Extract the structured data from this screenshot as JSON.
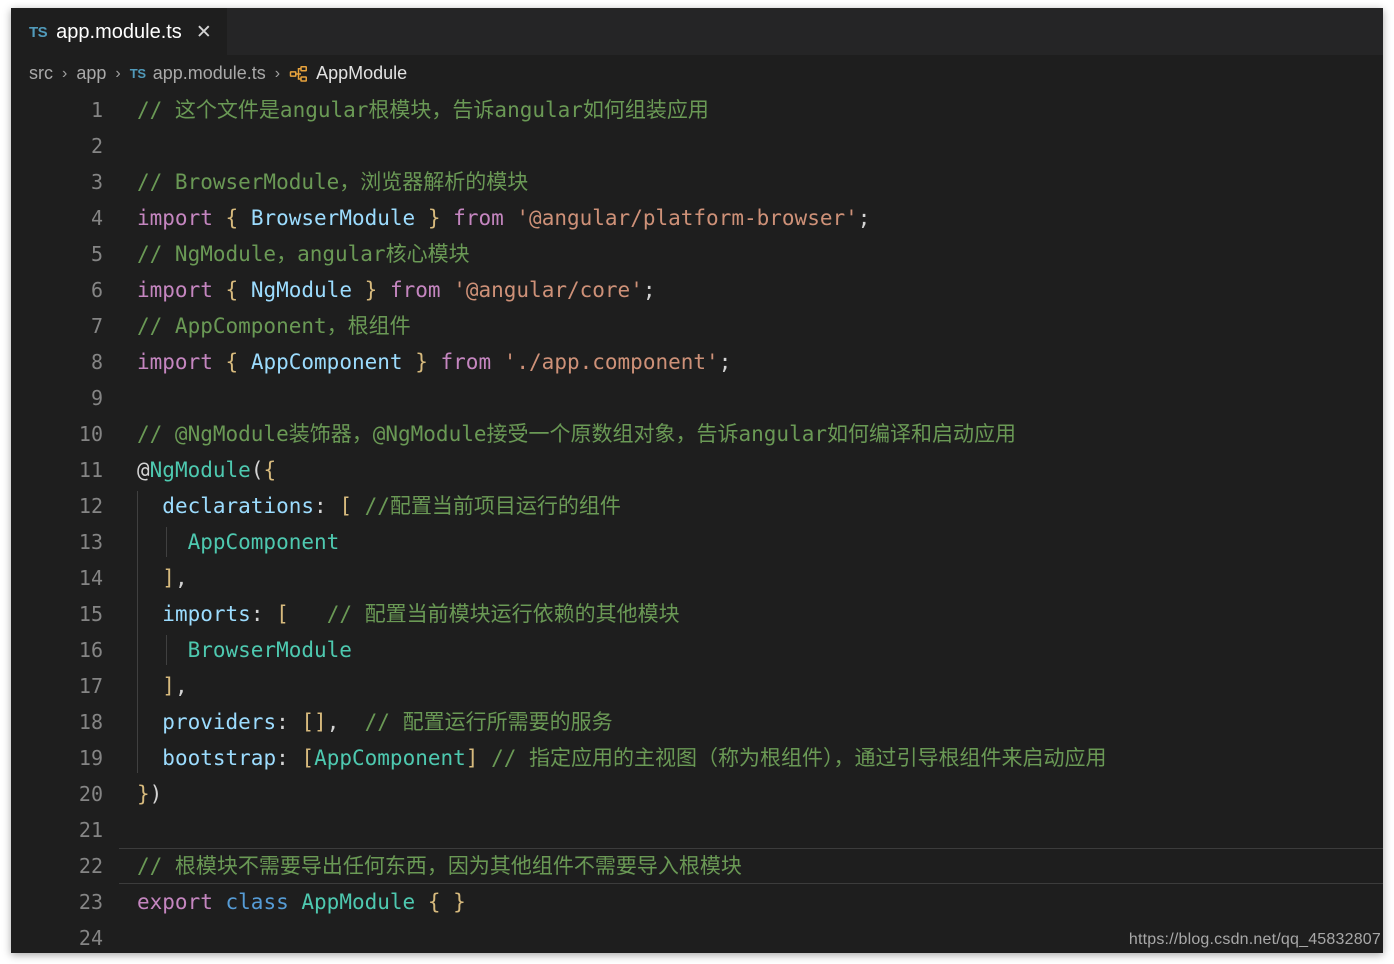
{
  "window": {
    "background_color": "#1e1e1e",
    "tabbar_color": "#252526"
  },
  "tab": {
    "icon_label": "TS",
    "icon_name": "typescript-file-icon",
    "filename": "app.module.ts",
    "close_label": "✕"
  },
  "breadcrumb": {
    "separator": "›",
    "items": [
      {
        "label": "src",
        "icon": "none"
      },
      {
        "label": "app",
        "icon": "none"
      },
      {
        "label": "app.module.ts",
        "icon": "typescript-file-icon",
        "icon_label": "TS"
      },
      {
        "label": "AppModule",
        "icon": "module-symbol-icon"
      }
    ]
  },
  "editor": {
    "current_line": 22,
    "total_visible_lines": 24,
    "lines": [
      {
        "n": 1,
        "tokens": [
          {
            "t": "// 这个文件是angular根模块，告诉angular如何组装应用",
            "c": "t-comment"
          }
        ]
      },
      {
        "n": 2,
        "tokens": []
      },
      {
        "n": 3,
        "tokens": [
          {
            "t": "// BrowserModule，浏览器解析的模块",
            "c": "t-comment"
          }
        ]
      },
      {
        "n": 4,
        "tokens": [
          {
            "t": "import",
            "c": "t-keyword"
          },
          {
            "t": " ",
            "c": "t-punct"
          },
          {
            "t": "{",
            "c": "t-brace"
          },
          {
            "t": " ",
            "c": "t-punct"
          },
          {
            "t": "BrowserModule",
            "c": "t-var"
          },
          {
            "t": " ",
            "c": "t-punct"
          },
          {
            "t": "}",
            "c": "t-brace"
          },
          {
            "t": " ",
            "c": "t-punct"
          },
          {
            "t": "from",
            "c": "t-keyword"
          },
          {
            "t": " ",
            "c": "t-punct"
          },
          {
            "t": "'@angular/platform-browser'",
            "c": "t-string"
          },
          {
            "t": ";",
            "c": "t-punct"
          }
        ]
      },
      {
        "n": 5,
        "tokens": [
          {
            "t": "// NgModule，angular核心模块",
            "c": "t-comment"
          }
        ]
      },
      {
        "n": 6,
        "tokens": [
          {
            "t": "import",
            "c": "t-keyword"
          },
          {
            "t": " ",
            "c": "t-punct"
          },
          {
            "t": "{",
            "c": "t-brace"
          },
          {
            "t": " ",
            "c": "t-punct"
          },
          {
            "t": "NgModule",
            "c": "t-var"
          },
          {
            "t": " ",
            "c": "t-punct"
          },
          {
            "t": "}",
            "c": "t-brace"
          },
          {
            "t": " ",
            "c": "t-punct"
          },
          {
            "t": "from",
            "c": "t-keyword"
          },
          {
            "t": " ",
            "c": "t-punct"
          },
          {
            "t": "'@angular/core'",
            "c": "t-string"
          },
          {
            "t": ";",
            "c": "t-punct"
          }
        ]
      },
      {
        "n": 7,
        "tokens": [
          {
            "t": "// AppComponent，根组件",
            "c": "t-comment"
          }
        ]
      },
      {
        "n": 8,
        "tokens": [
          {
            "t": "import",
            "c": "t-keyword"
          },
          {
            "t": " ",
            "c": "t-punct"
          },
          {
            "t": "{",
            "c": "t-brace"
          },
          {
            "t": " ",
            "c": "t-punct"
          },
          {
            "t": "AppComponent",
            "c": "t-var"
          },
          {
            "t": " ",
            "c": "t-punct"
          },
          {
            "t": "}",
            "c": "t-brace"
          },
          {
            "t": " ",
            "c": "t-punct"
          },
          {
            "t": "from",
            "c": "t-keyword"
          },
          {
            "t": " ",
            "c": "t-punct"
          },
          {
            "t": "'./app.component'",
            "c": "t-string"
          },
          {
            "t": ";",
            "c": "t-punct"
          }
        ]
      },
      {
        "n": 9,
        "tokens": []
      },
      {
        "n": 10,
        "tokens": [
          {
            "t": "// @NgModule装饰器，@NgModule接受一个原数组对象，告诉angular如何编译和启动应用",
            "c": "t-comment"
          }
        ]
      },
      {
        "n": 11,
        "tokens": [
          {
            "t": "@",
            "c": "t-punct"
          },
          {
            "t": "NgModule",
            "c": "t-type"
          },
          {
            "t": "(",
            "c": "t-punct"
          },
          {
            "t": "{",
            "c": "t-brace"
          }
        ]
      },
      {
        "n": 12,
        "tokens": [
          {
            "t": "  ",
            "c": "t-punct"
          },
          {
            "t": "declarations",
            "c": "t-var"
          },
          {
            "t": ":",
            "c": "t-punct"
          },
          {
            "t": " ",
            "c": "t-punct"
          },
          {
            "t": "[",
            "c": "t-bracket"
          },
          {
            "t": " ",
            "c": "t-punct"
          },
          {
            "t": "//配置当前项目运行的组件",
            "c": "t-comment"
          }
        ]
      },
      {
        "n": 13,
        "tokens": [
          {
            "t": "    ",
            "c": "t-punct"
          },
          {
            "t": "AppComponent",
            "c": "t-type"
          }
        ]
      },
      {
        "n": 14,
        "tokens": [
          {
            "t": "  ",
            "c": "t-punct"
          },
          {
            "t": "]",
            "c": "t-bracket"
          },
          {
            "t": ",",
            "c": "t-punct"
          }
        ]
      },
      {
        "n": 15,
        "tokens": [
          {
            "t": "  ",
            "c": "t-punct"
          },
          {
            "t": "imports",
            "c": "t-var"
          },
          {
            "t": ":",
            "c": "t-punct"
          },
          {
            "t": " ",
            "c": "t-punct"
          },
          {
            "t": "[",
            "c": "t-bracket"
          },
          {
            "t": "   ",
            "c": "t-punct"
          },
          {
            "t": "// 配置当前模块运行依赖的其他模块",
            "c": "t-comment"
          }
        ]
      },
      {
        "n": 16,
        "tokens": [
          {
            "t": "    ",
            "c": "t-punct"
          },
          {
            "t": "BrowserModule",
            "c": "t-type"
          }
        ]
      },
      {
        "n": 17,
        "tokens": [
          {
            "t": "  ",
            "c": "t-punct"
          },
          {
            "t": "]",
            "c": "t-bracket"
          },
          {
            "t": ",",
            "c": "t-punct"
          }
        ]
      },
      {
        "n": 18,
        "tokens": [
          {
            "t": "  ",
            "c": "t-punct"
          },
          {
            "t": "providers",
            "c": "t-var"
          },
          {
            "t": ":",
            "c": "t-punct"
          },
          {
            "t": " ",
            "c": "t-punct"
          },
          {
            "t": "[]",
            "c": "t-bracket"
          },
          {
            "t": ",",
            "c": "t-punct"
          },
          {
            "t": "  ",
            "c": "t-punct"
          },
          {
            "t": "// 配置运行所需要的服务",
            "c": "t-comment"
          }
        ]
      },
      {
        "n": 19,
        "tokens": [
          {
            "t": "  ",
            "c": "t-punct"
          },
          {
            "t": "bootstrap",
            "c": "t-var"
          },
          {
            "t": ":",
            "c": "t-punct"
          },
          {
            "t": " ",
            "c": "t-punct"
          },
          {
            "t": "[",
            "c": "t-bracket"
          },
          {
            "t": "AppComponent",
            "c": "t-type"
          },
          {
            "t": "]",
            "c": "t-bracket"
          },
          {
            "t": " ",
            "c": "t-punct"
          },
          {
            "t": "// 指定应用的主视图（称为根组件），通过引导根组件来启动应用",
            "c": "t-comment"
          }
        ]
      },
      {
        "n": 20,
        "tokens": [
          {
            "t": "}",
            "c": "t-brace"
          },
          {
            "t": ")",
            "c": "t-punct"
          }
        ]
      },
      {
        "n": 21,
        "tokens": []
      },
      {
        "n": 22,
        "tokens": [
          {
            "t": "// 根模块不需要导出任何东西，因为其他组件不需要导入根模块",
            "c": "t-comment"
          }
        ]
      },
      {
        "n": 23,
        "tokens": [
          {
            "t": "export",
            "c": "t-keyword"
          },
          {
            "t": " ",
            "c": "t-punct"
          },
          {
            "t": "class",
            "c": "t-ctrl"
          },
          {
            "t": " ",
            "c": "t-punct"
          },
          {
            "t": "AppModule",
            "c": "t-type"
          },
          {
            "t": " ",
            "c": "t-punct"
          },
          {
            "t": "{",
            "c": "t-brace"
          },
          {
            "t": " ",
            "c": "t-punct"
          },
          {
            "t": "}",
            "c": "t-brace"
          }
        ]
      },
      {
        "n": 24,
        "tokens": []
      }
    ],
    "indent_guides": [
      {
        "line_from": 12,
        "line_to": 19,
        "col": 1
      },
      {
        "line_from": 13,
        "line_to": 13,
        "col": 2
      },
      {
        "line_from": 16,
        "line_to": 16,
        "col": 2
      }
    ]
  },
  "watermark": {
    "text": "https://blog.csdn.net/qq_45832807"
  },
  "colors": {
    "background": "#1e1e1e",
    "tabbar": "#252526",
    "comment": "#6a9955",
    "keyword": "#c586c0",
    "control": "#569cd6",
    "variable": "#9cdcfe",
    "type": "#4ec9b0",
    "string": "#ce9178",
    "bracket": "#d7ba7d",
    "linenumber": "#858585",
    "accent_ts": "#519aba",
    "accent_module": "#e8a33d"
  }
}
